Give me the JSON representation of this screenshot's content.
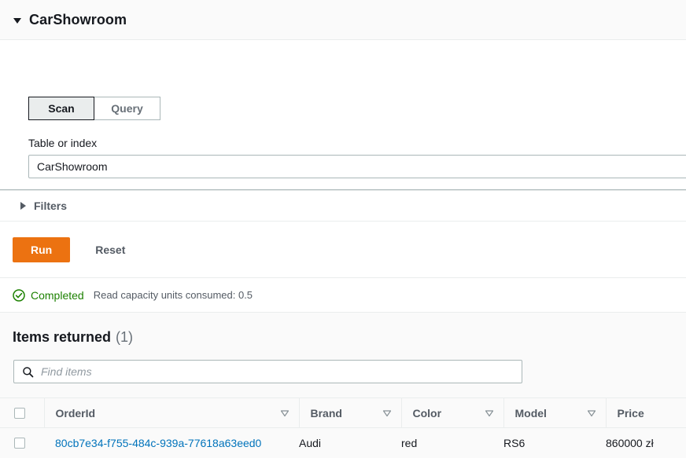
{
  "panel": {
    "title": "CarShowroom",
    "caret_icon": "caret-down-icon"
  },
  "operation_tabs": [
    {
      "label": "Scan",
      "selected": true
    },
    {
      "label": "Query",
      "selected": false
    }
  ],
  "table_field": {
    "label": "Table or index",
    "value": "CarShowroom"
  },
  "filters": {
    "label": "Filters",
    "caret_icon": "caret-right-icon",
    "expanded": false
  },
  "actions": {
    "run_label": "Run",
    "reset_label": "Reset",
    "run_color": "#ec7211"
  },
  "status": {
    "icon": "status-success-icon",
    "text": "Completed",
    "meta": "Read capacity units consumed: 0.5",
    "color": "#1d8102"
  },
  "results": {
    "title": "Items returned",
    "count": "(1)",
    "search": {
      "icon": "search-icon",
      "placeholder": "Find items",
      "value": ""
    },
    "columns": [
      {
        "label": "OrderId",
        "sort_icon": "sort-descending-icon"
      },
      {
        "label": "Brand",
        "sort_icon": "sort-descending-icon"
      },
      {
        "label": "Color",
        "sort_icon": "sort-descending-icon"
      },
      {
        "label": "Model",
        "sort_icon": "sort-descending-icon"
      },
      {
        "label": "Price",
        "sort_icon": ""
      }
    ],
    "rows": [
      {
        "orderId": "80cb7e34-f755-484c-939a-77618a63eed0",
        "brand": "Audi",
        "color": "red",
        "model": "RS6",
        "price": "860000 zł"
      }
    ]
  }
}
